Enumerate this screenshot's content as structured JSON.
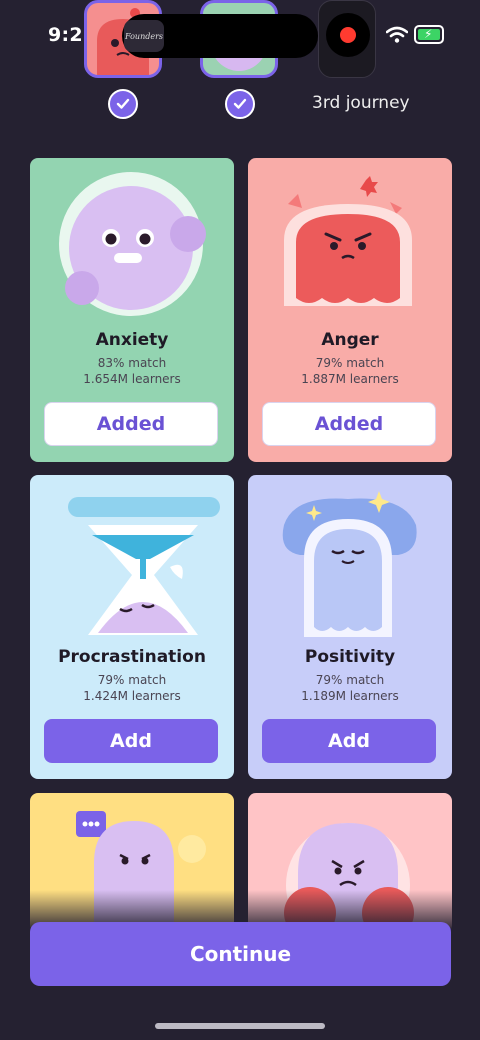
{
  "status_bar": {
    "time": "9:21"
  },
  "island": {
    "label": "Founders"
  },
  "journeys": {
    "third_label": "3rd journey"
  },
  "cards": [
    {
      "name": "Anxiety",
      "match": "83% match",
      "learners": "1.654M learners",
      "button": "Added",
      "bg": "#93d4b1"
    },
    {
      "name": "Anger",
      "match": "79% match",
      "learners": "1.887M learners",
      "button": "Added",
      "bg": "#f9aca8"
    },
    {
      "name": "Procrastination",
      "match": "79% match",
      "learners": "1.424M learners",
      "button": "Add",
      "bg": "#ccebfa"
    },
    {
      "name": "Positivity",
      "match": "79% match",
      "learners": "1.189M learners",
      "button": "Add",
      "bg": "#c7cdf9"
    },
    {
      "bg": "#ffdf82"
    },
    {
      "bg": "#ffc4c6"
    }
  ],
  "footer": {
    "continue_label": "Continue"
  },
  "colors": {
    "accent": "#7b63e8",
    "background": "#252131"
  }
}
